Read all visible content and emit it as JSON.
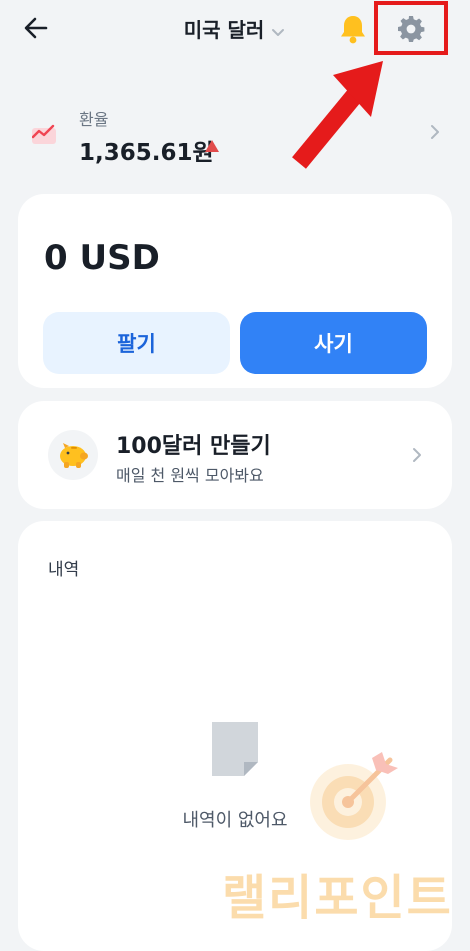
{
  "header": {
    "title": "미국 달러"
  },
  "rate": {
    "label": "환율",
    "value": "1,365.61원"
  },
  "balance": {
    "amount": "0 USD",
    "sell_label": "팔기",
    "buy_label": "사기"
  },
  "promo": {
    "title": "100달러 만들기",
    "subtitle": "매일 천 원씩 모아봐요"
  },
  "history": {
    "title": "내역",
    "empty_text": "내역이 없어요"
  },
  "watermark": {
    "text": "랠리포인트"
  },
  "colors": {
    "background": "#f2f4f6",
    "primary": "#3182f6",
    "secondary_button": "#e8f3ff",
    "up_red": "#e14b4b",
    "highlight": "#e51b1b"
  }
}
